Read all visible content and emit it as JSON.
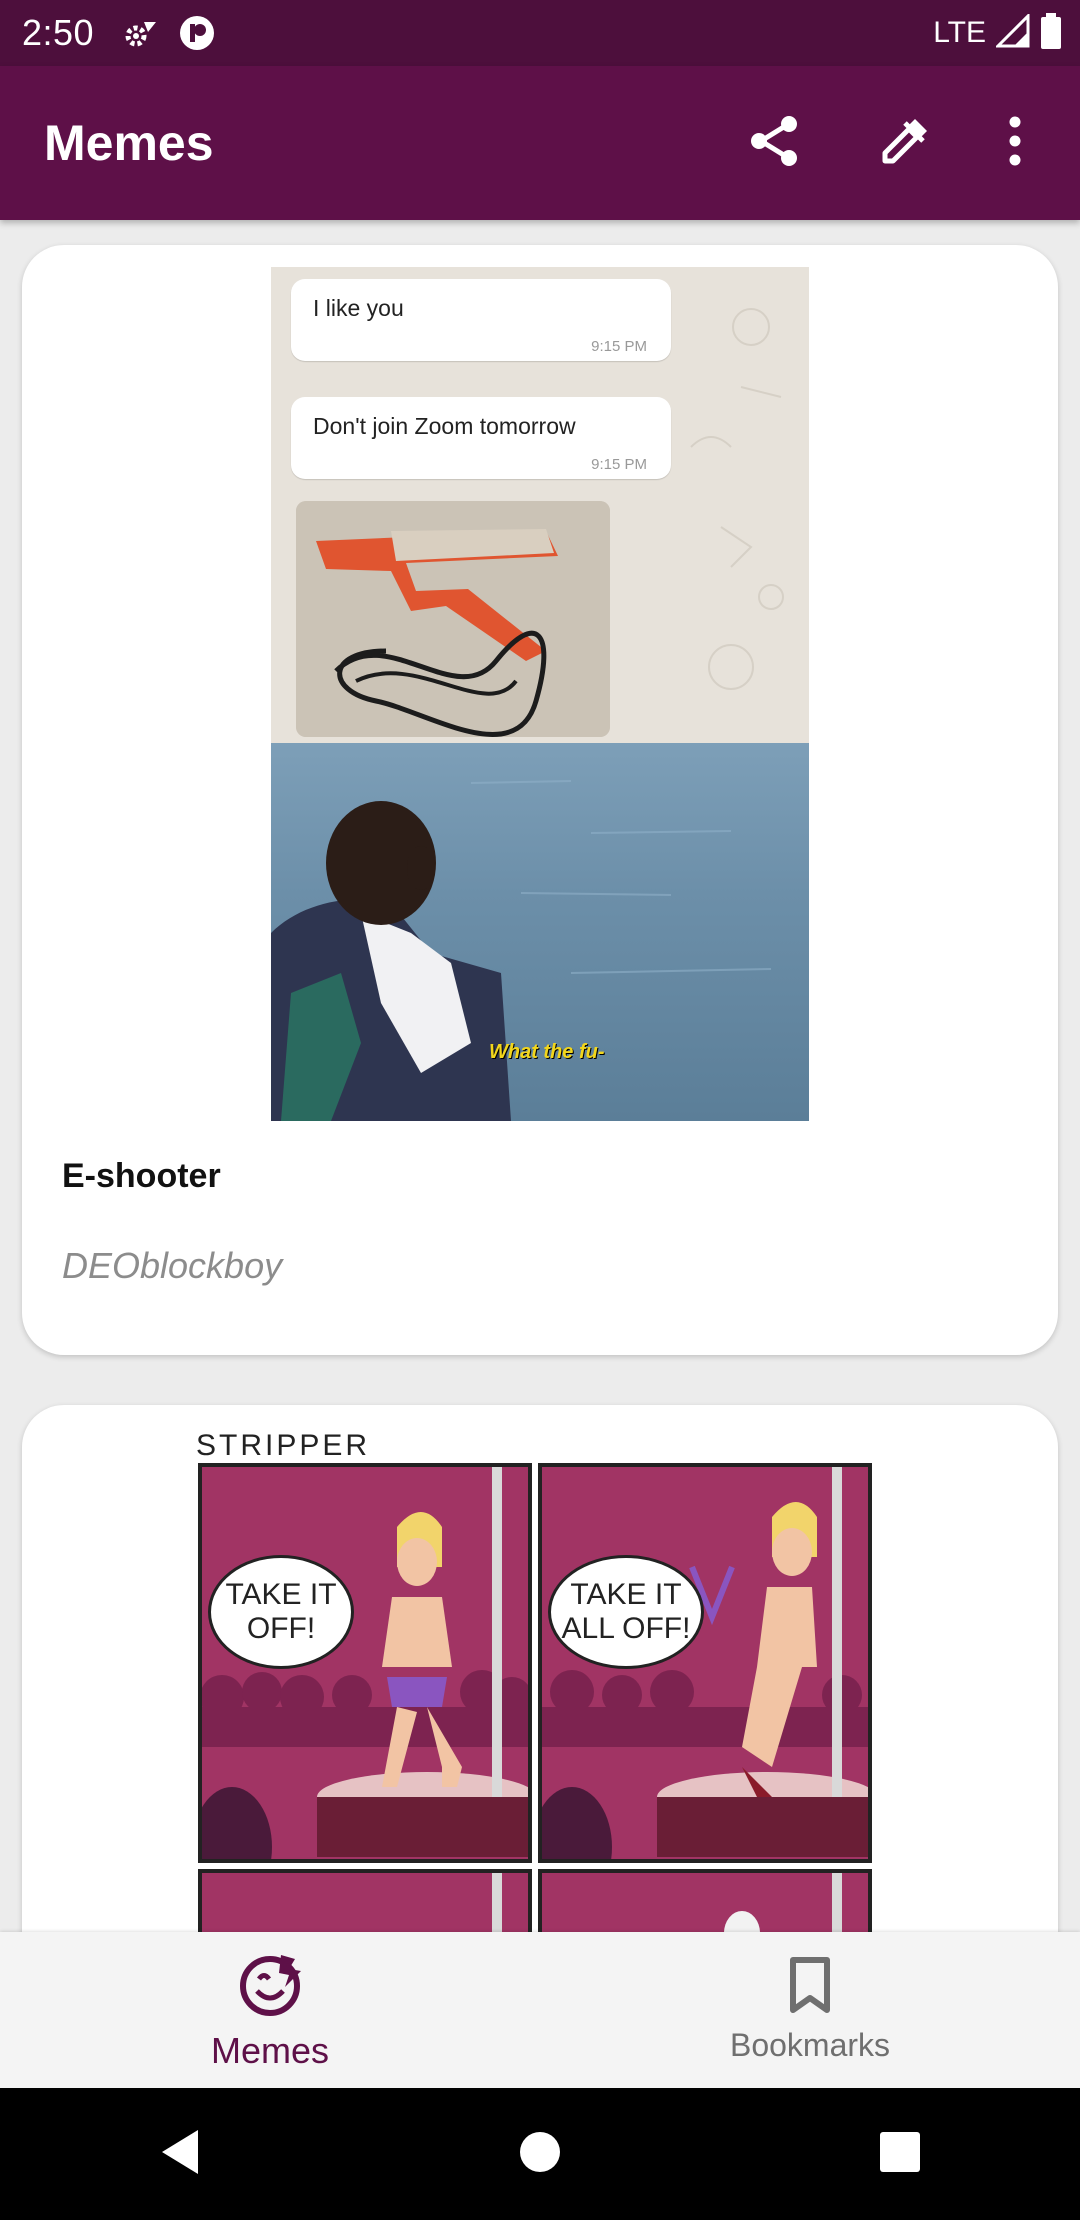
{
  "status_bar": {
    "time": "2:50",
    "network": "LTE",
    "icons": [
      "settings-icon",
      "app-notification-icon",
      "signal-icon",
      "battery-icon"
    ]
  },
  "app_bar": {
    "title": "Memes",
    "actions": [
      "share-icon",
      "eyedropper-icon",
      "more-vert-icon"
    ]
  },
  "feed": [
    {
      "title": "E-shooter",
      "author": "DEOblockboy",
      "image": {
        "chat_messages": [
          {
            "text": "I like you",
            "time": "9:15 PM"
          },
          {
            "text": "Don't join Zoom tomorrow",
            "time": "9:15 PM"
          }
        ],
        "caption": "What the fu-"
      }
    },
    {
      "image": {
        "title": "STRIPPER",
        "bubbles": [
          "TAKE IT\nOFF!",
          "TAKE IT\nALL OFF!"
        ]
      }
    }
  ],
  "bottom_nav": {
    "items": [
      {
        "label": "Memes",
        "icon": "memes-icon",
        "active": true
      },
      {
        "label": "Bookmarks",
        "icon": "bookmark-icon",
        "active": false
      }
    ]
  },
  "colors": {
    "primary": "#5e1048",
    "status_bar": "#4d0f3c",
    "background": "#ececec"
  }
}
